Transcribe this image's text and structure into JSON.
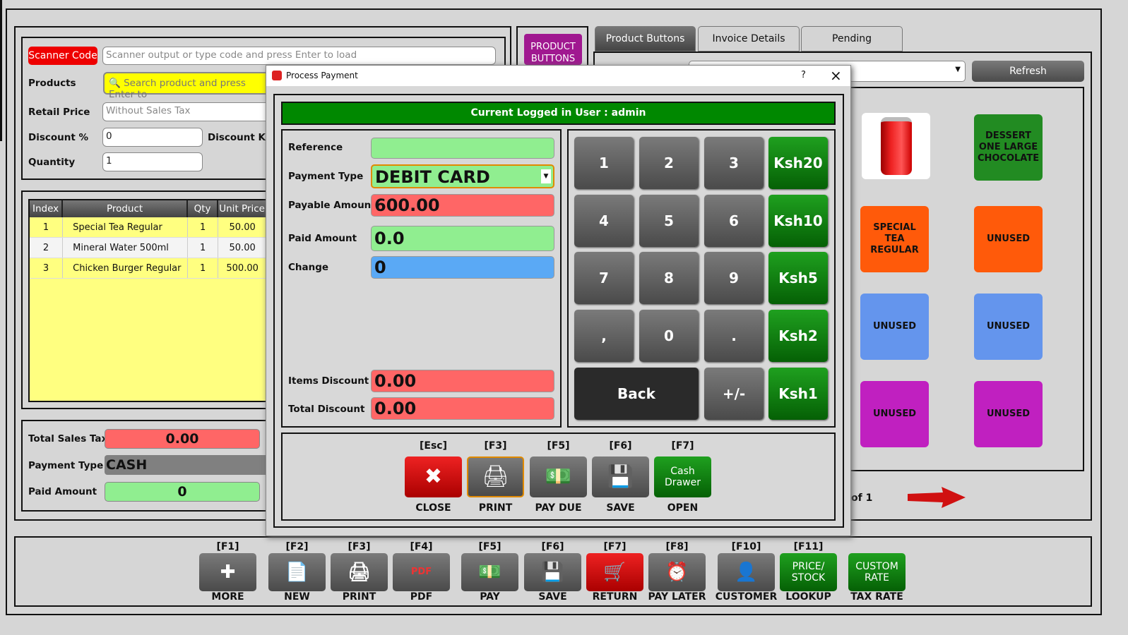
{
  "left": {
    "scanner_label": "Scanner Code",
    "scanner_placeholder": "Scanner output or type code and press Enter to load",
    "products_label": "Products",
    "products_placeholder": "Search product and press Enter to",
    "retail_label": "Retail Price",
    "retail_placeholder": "Without Sales Tax",
    "discount_pct_label": "Discount %",
    "discount_pct_value": "0",
    "discount_ksh_label": "Discount Ksh",
    "quantity_label": "Quantity",
    "quantity_value": "1"
  },
  "table": {
    "headers": [
      "Index",
      "Product",
      "Qty",
      "Unit Price"
    ],
    "rows": [
      [
        "1",
        "Special Tea Regular",
        "1",
        "50.00"
      ],
      [
        "2",
        "Mineral Water 500ml",
        "1",
        "50.00"
      ],
      [
        "3",
        "Chicken Burger Regular",
        "1",
        "500.00"
      ]
    ]
  },
  "totals": {
    "tax_label": "Total Sales Tax",
    "tax_value": "0.00",
    "payment_type_label": "Payment Type",
    "payment_type_value": "CASH",
    "paid_label": "Paid Amount",
    "paid_value": "0"
  },
  "product_buttons_btn": "PRODUCT BUTTONS",
  "tabs": [
    "Product Buttons",
    "Invoice Details",
    "Pending"
  ],
  "refresh_label": "Refresh",
  "tiles": [
    {
      "label": "",
      "image": "coca-cola-can",
      "color": "#ffffff"
    },
    {
      "label": "DESSERT ONE LARGE CHOCOLATE",
      "color": "#228b22"
    },
    {
      "label": "SPECIAL TEA REGULAR",
      "color": "#ff5a0a"
    },
    {
      "label": "UNUSED",
      "color": "#ff5a0a"
    },
    {
      "label": "UNUSED",
      "color": "#6495ed"
    },
    {
      "label": "UNUSED",
      "color": "#6495ed"
    },
    {
      "label": "UNUSED",
      "color": "#c020c0"
    },
    {
      "label": "UNUSED",
      "color": "#c020c0"
    }
  ],
  "page_info": "of 1",
  "dialog": {
    "title": "Process Payment",
    "help": "?",
    "banner": "Current Logged in User : admin",
    "reference_label": "Reference",
    "reference_value": "",
    "payment_type_label": "Payment Type",
    "payment_type_value": "DEBIT CARD",
    "payable_label": "Payable Amount",
    "payable_value": "600.00",
    "paid_label": "Paid Amount",
    "paid_value": "0.0",
    "change_label": "Change",
    "change_value": "0",
    "items_discount_label": "Items Discount",
    "items_discount_value": "0.00",
    "total_discount_label": "Total Discount",
    "total_discount_value": "0.00",
    "keypad": [
      [
        "1",
        "2",
        "3",
        "Ksh20"
      ],
      [
        "4",
        "5",
        "6",
        "Ksh10"
      ],
      [
        "7",
        "8",
        "9",
        "Ksh5"
      ],
      [
        ",",
        "0",
        ".",
        "Ksh2"
      ],
      [
        "Back",
        "+/-",
        "Ksh1"
      ]
    ],
    "actions": [
      {
        "key": "[Esc]",
        "label": "CLOSE",
        "icon": "close-icon"
      },
      {
        "key": "[F3]",
        "label": "PRINT",
        "icon": "printer-icon"
      },
      {
        "key": "[F5]",
        "label": "PAY DUE",
        "icon": "cash-icon"
      },
      {
        "key": "[F6]",
        "label": "SAVE",
        "icon": "save-icon"
      },
      {
        "key": "[F7]",
        "label": "OPEN",
        "text": "Cash Drawer"
      }
    ]
  },
  "toolbar": [
    {
      "key": "[F1]",
      "label": "MORE",
      "icon": "gear-plus-icon"
    },
    {
      "key": "[F2]",
      "label": "NEW",
      "icon": "new-document-icon"
    },
    {
      "key": "[F3]",
      "label": "PRINT",
      "icon": "printer-icon"
    },
    {
      "key": "[F4]",
      "label": "PDF",
      "icon": "pdf-icon"
    },
    {
      "key": "[F5]",
      "label": "PAY",
      "icon": "cash-icon"
    },
    {
      "key": "[F6]",
      "label": "SAVE",
      "icon": "save-icon"
    },
    {
      "key": "[F7]",
      "label": "RETURN",
      "icon": "cart-return-icon"
    },
    {
      "key": "[F8]",
      "label": "PAY LATER",
      "icon": "clock-pay-icon"
    },
    {
      "key": "[F10]",
      "label": "CUSTOMER",
      "icon": "customer-icon"
    },
    {
      "key": "[F11]",
      "label": "LOOKUP",
      "text": "PRICE/ STOCK"
    },
    {
      "key": "",
      "label": "TAX RATE",
      "text": "CUSTOM RATE"
    }
  ]
}
